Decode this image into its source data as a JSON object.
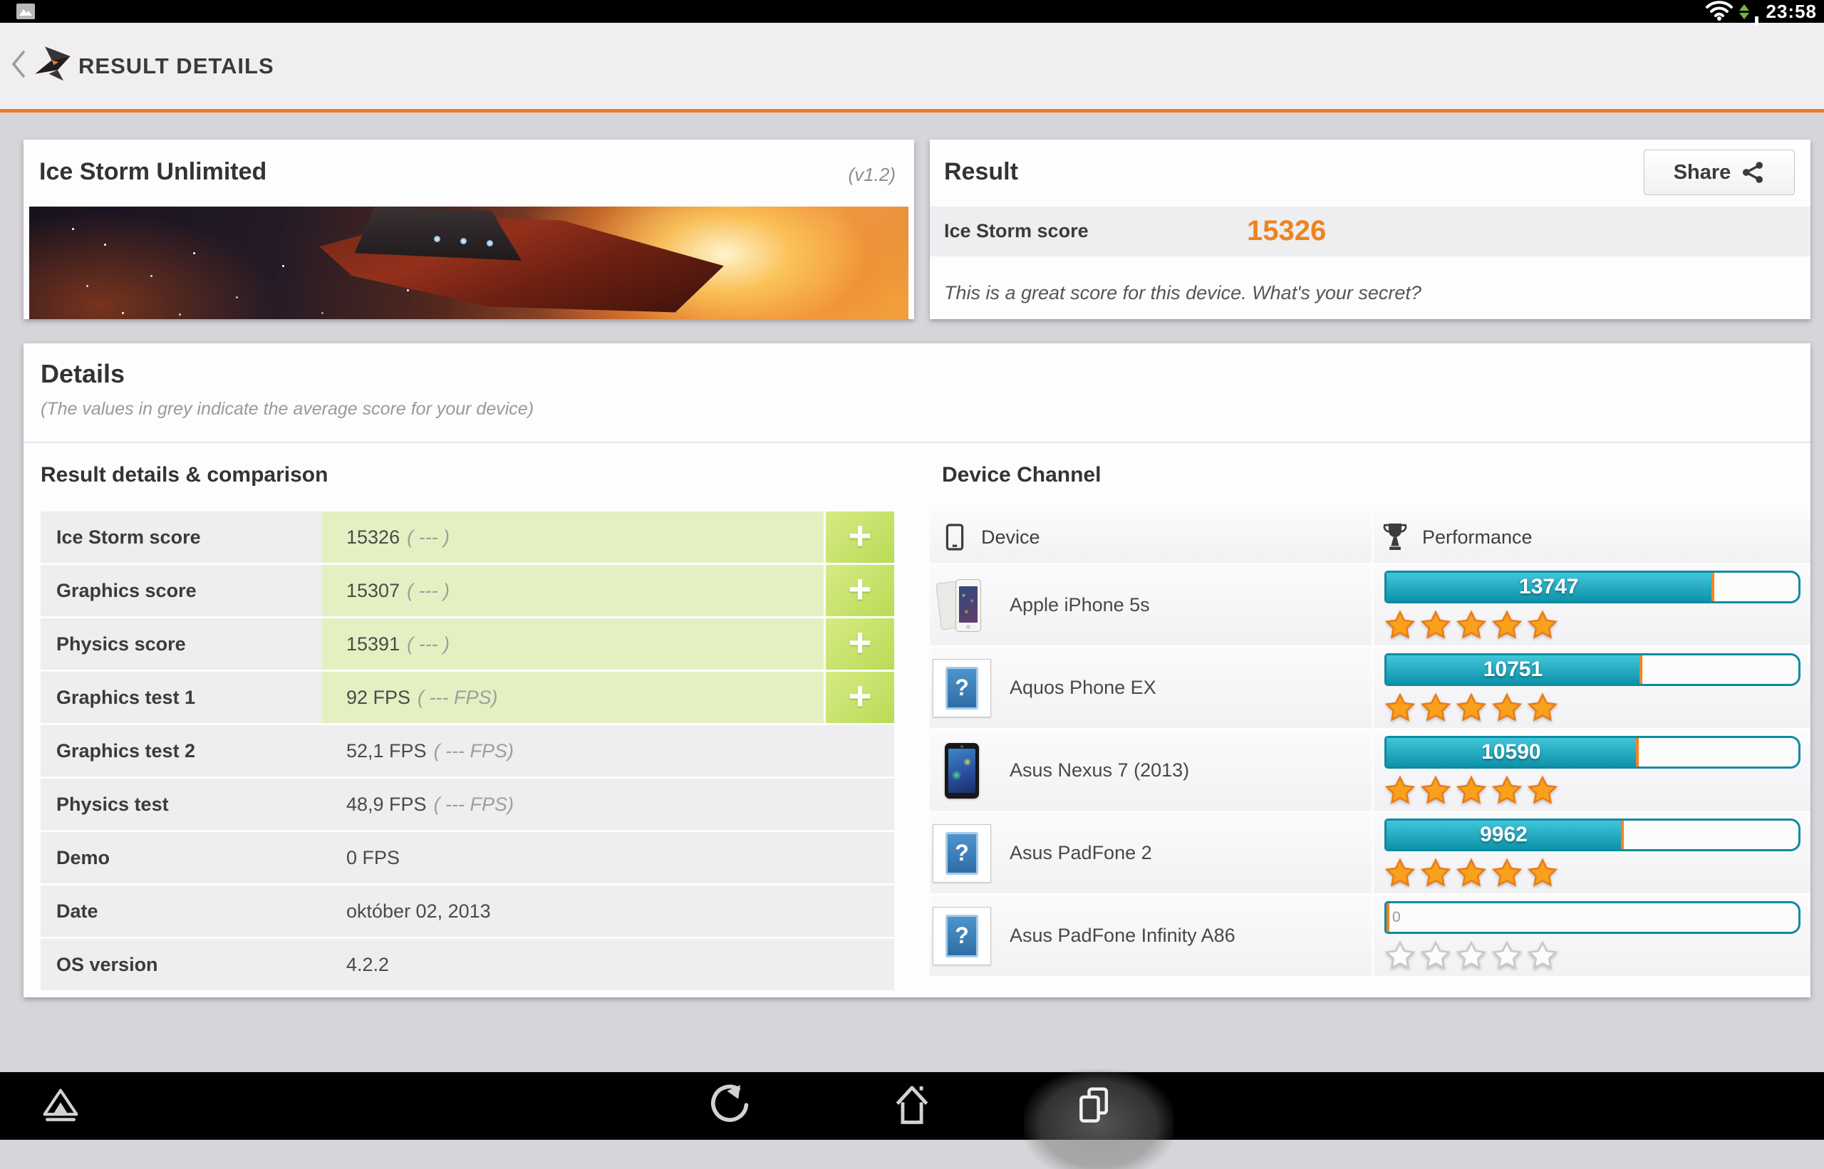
{
  "status_bar": {
    "time": "23:58",
    "icons": [
      "screenshot-icon",
      "wifi-icon",
      "network-arrows-icon",
      "battery-icon"
    ]
  },
  "header": {
    "title": "RESULT DETAILS",
    "icons": [
      "back-chevron-icon",
      "3dmark-logo"
    ]
  },
  "colors": {
    "accent_orange": "#e87c2b",
    "score_orange": "#f0821e",
    "bar_teal": "#0d93aa",
    "highlight_green": "#e5f0c2",
    "star_orange": "#f9a11b"
  },
  "test_card": {
    "title": "Ice Storm Unlimited",
    "version": "(v1.2)"
  },
  "result_card": {
    "title": "Result",
    "share_label": "Share",
    "score_label": "Ice Storm score",
    "score_value": "15326",
    "comment": "This is a great score for this device. What's your secret?"
  },
  "details": {
    "title": "Details",
    "note": "(The values in grey indicate the average score for your device)",
    "comparison": {
      "title": "Result details & comparison",
      "rows": [
        {
          "label": "Ice Storm score",
          "value": "15326",
          "average": "( --- )",
          "highlight": true,
          "expandable": true
        },
        {
          "label": "Graphics score",
          "value": "15307",
          "average": "( --- )",
          "highlight": true,
          "expandable": true
        },
        {
          "label": "Physics score",
          "value": "15391",
          "average": "( --- )",
          "highlight": true,
          "expandable": true
        },
        {
          "label": "Graphics test 1",
          "value": "92 FPS",
          "average": "( --- FPS)",
          "highlight": true,
          "expandable": true
        },
        {
          "label": "Graphics test 2",
          "value": "52,1 FPS",
          "average": "( --- FPS)",
          "highlight": false,
          "expandable": false
        },
        {
          "label": "Physics test",
          "value": "48,9 FPS",
          "average": "( --- FPS)",
          "highlight": false,
          "expandable": false
        },
        {
          "label": "Demo",
          "value": "0 FPS",
          "average": "",
          "highlight": false,
          "expandable": false
        },
        {
          "label": "Date",
          "value": "október 02, 2013",
          "average": "",
          "highlight": false,
          "expandable": false
        },
        {
          "label": "OS version",
          "value": "4.2.2",
          "average": "",
          "highlight": false,
          "expandable": false
        }
      ]
    },
    "device_channel": {
      "title": "Device Channel",
      "device_header": "Device",
      "performance_header": "Performance",
      "bar_max_scale": 17300,
      "devices": [
        {
          "name": "Apple iPhone 5s",
          "score": 13747,
          "score_label": "13747",
          "stars": 5,
          "icon": "iphone"
        },
        {
          "name": "Aquos Phone EX",
          "score": 10751,
          "score_label": "10751",
          "stars": 5,
          "icon": "unknown"
        },
        {
          "name": "Asus Nexus 7 (2013)",
          "score": 10590,
          "score_label": "10590",
          "stars": 5,
          "icon": "nexus7"
        },
        {
          "name": "Asus PadFone 2",
          "score": 9962,
          "score_label": "9962",
          "stars": 5,
          "icon": "unknown"
        },
        {
          "name": "Asus PadFone Infinity A86",
          "score": 0,
          "score_label": "0",
          "stars": 0,
          "icon": "unknown"
        }
      ]
    }
  },
  "nav_bar": {
    "icons": [
      "small-apps-icon",
      "back-icon",
      "home-icon",
      "recent-apps-icon"
    ]
  }
}
